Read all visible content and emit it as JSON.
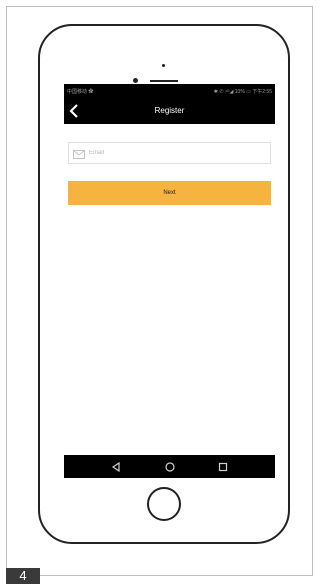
{
  "status_bar": {
    "left_text": "中国移动 ✿",
    "right_text": "✱ ✆ ⁴ᴳ◢ 10% ▭ 下午2:55"
  },
  "app_bar": {
    "title": "Register",
    "back_icon": "chevron-left-icon"
  },
  "form": {
    "email_placeholder": "Email",
    "email_value": "",
    "email_icon": "envelope-icon",
    "next_label": "Next"
  },
  "nav_bar": {
    "icons": [
      "back-triangle-icon",
      "home-circle-icon",
      "recents-square-icon"
    ]
  },
  "page_number": "4",
  "colors": {
    "bars": "#000000",
    "button": "#f5b33f",
    "page_badge": "#3a3a3a"
  }
}
